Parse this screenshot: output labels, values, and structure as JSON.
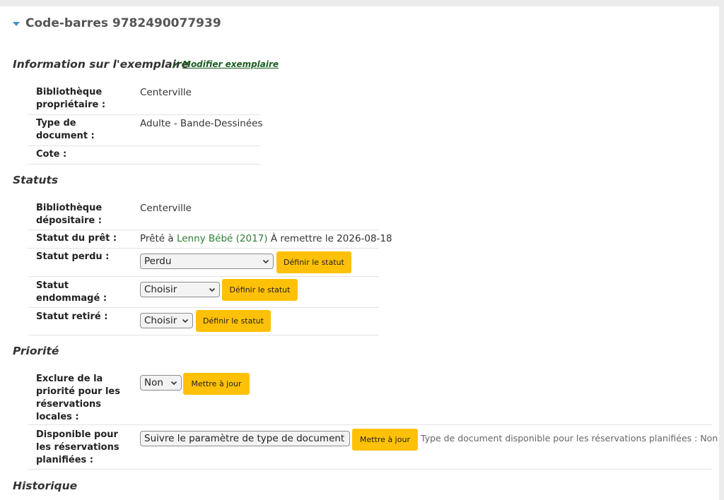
{
  "header": {
    "title": "Code-barres 9782490077939"
  },
  "item_info": {
    "heading": "Information sur l'exemplaire",
    "edit_link": "Modifier exemplaire",
    "rows": [
      {
        "label": "Bibliothèque propriétaire :",
        "value": "Centerville"
      },
      {
        "label": "Type de document :",
        "value": "Adulte - Bande-Dessinées"
      },
      {
        "label": "Cote :",
        "value": ""
      }
    ]
  },
  "statuses": {
    "heading": "Statuts",
    "holding_library": {
      "label": "Bibliothèque dépositaire :",
      "value": "Centerville"
    },
    "loan_status": {
      "label": "Statut du prêt :",
      "prefix": "Prêté à",
      "patron": "Lenny Bébé (2017)",
      "suffix": "À remettre le 2026-08-18"
    },
    "lost": {
      "label": "Statut perdu :",
      "selected": "Perdu",
      "button": "Définir le statut"
    },
    "damaged": {
      "label": "Statut endommagé :",
      "selected": "Choisir",
      "button": "Définir le statut"
    },
    "withdrawn": {
      "label": "Statut retiré :",
      "selected": "Choisir",
      "button": "Définir le statut"
    }
  },
  "priority": {
    "heading": "Priorité",
    "exclude_local": {
      "label": "Exclure de la priorité pour les réservations locales :",
      "selected": "Non",
      "button": "Mettre à jour"
    },
    "bookable": {
      "label": "Disponible pour les réservations planifiées :",
      "selected": "Suivre le paramètre de type de document",
      "button": "Mettre à jour",
      "hint": "Type de document disponible pour les réservations planifiées : Non"
    }
  },
  "history": {
    "heading": "Historique"
  },
  "colors": {
    "accent": "#ffc107",
    "link": "#2e7d32",
    "caret": "#408fc9"
  }
}
